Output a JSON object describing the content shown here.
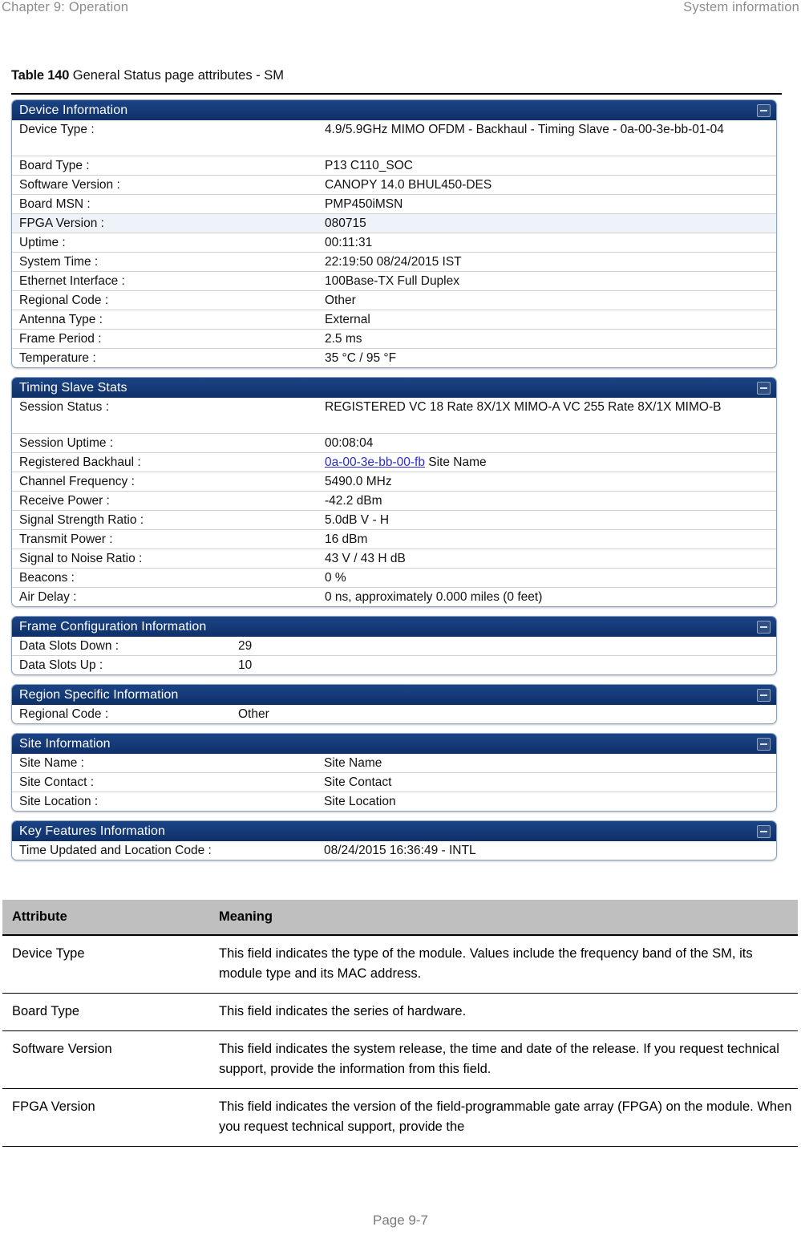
{
  "running_head": {
    "left": "Chapter 9:  Operation",
    "right": "System information"
  },
  "caption": {
    "number": "Table 140",
    "text": "General Status page attributes - SM"
  },
  "colors": {
    "panel_header_bg": "#123a77",
    "panel_border": "#8ea4bf",
    "row_highlight": "#eef3fa",
    "link": "#2b2bcc",
    "table_header_bg": "#bfbfbf"
  },
  "screenshot": {
    "collapse_icon": "minus-icon",
    "panels": [
      {
        "title": "Device Information",
        "rows": [
          {
            "label": "Device Type :",
            "value": "4.9/5.9GHz MIMO OFDM - Backhaul - Timing Slave - 0a-00-3e-bb-01-04",
            "two_line": true
          },
          {
            "label": "Board Type :",
            "value": "P13 C110_SOC"
          },
          {
            "label": "Software Version :",
            "value": "CANOPY 14.0  BHUL450-DES"
          },
          {
            "label": "Board MSN :",
            "value": "PMP450iMSN"
          },
          {
            "label": "FPGA Version :",
            "value": "080715",
            "highlight": true
          },
          {
            "label": "Uptime :",
            "value": "00:11:31"
          },
          {
            "label": "System Time :",
            "value": "22:19:50 08/24/2015 IST"
          },
          {
            "label": "Ethernet Interface :",
            "value": "100Base-TX Full Duplex"
          },
          {
            "label": "Regional Code :",
            "value": "Other"
          },
          {
            "label": "Antenna Type :",
            "value": "External"
          },
          {
            "label": "Frame Period :",
            "value": "2.5 ms"
          },
          {
            "label": "Temperature :",
            "value": "35 °C / 95 °F"
          }
        ]
      },
      {
        "title": "Timing Slave Stats",
        "rows": [
          {
            "label": "Session Status :",
            "value": "REGISTERED VC 18 Rate 8X/1X MIMO-A VC 255 Rate 8X/1X MIMO-B",
            "two_line": true
          },
          {
            "label": "Session Uptime :",
            "value": "00:08:04"
          },
          {
            "label": "Registered Backhaul :",
            "value": "0a-00-3e-bb-00-fb Site Name",
            "link_text": "0a-00-3e-bb-00-fb",
            "link_suffix": " Site Name"
          },
          {
            "label": "Channel Frequency :",
            "value": "5490.0 MHz"
          },
          {
            "label": "Receive Power :",
            "value": "-42.2 dBm"
          },
          {
            "label": "Signal Strength Ratio :",
            "value": "5.0dB V - H"
          },
          {
            "label": "Transmit Power :",
            "value": "16 dBm"
          },
          {
            "label": "Signal to Noise Ratio :",
            "value": "43 V / 43 H dB"
          },
          {
            "label": "Beacons :",
            "value": "0 %"
          },
          {
            "label": "Air Delay :",
            "value": "0 ns, approximately 0.000 miles (0 feet)"
          }
        ]
      },
      {
        "title": "Frame Configuration Information",
        "rows": [
          {
            "label": "Data Slots Down :",
            "value": "29"
          },
          {
            "label": "Data Slots Up :",
            "value": "10"
          }
        ]
      },
      {
        "title": "Region Specific Information",
        "rows": [
          {
            "label": "Regional Code :",
            "value": "Other"
          }
        ]
      },
      {
        "title": "Site Information",
        "rows": [
          {
            "label": "Site Name :",
            "value": "Site Name"
          },
          {
            "label": "Site Contact :",
            "value": "Site Contact"
          },
          {
            "label": "Site Location :",
            "value": "Site Location"
          }
        ]
      },
      {
        "title": "Key Features Information",
        "rows": [
          {
            "label": "Time Updated and Location Code :",
            "value": "08/24/2015 16:36:49 - INTL"
          }
        ]
      }
    ]
  },
  "attribute_table": {
    "headers": [
      "Attribute",
      "Meaning"
    ],
    "rows": [
      {
        "attribute": "Device Type",
        "meaning": "This field indicates the type of the module. Values include the frequency band of the SM, its module type and its MAC address."
      },
      {
        "attribute": "Board Type",
        "meaning": "This field indicates the series of hardware."
      },
      {
        "attribute": "Software Version",
        "meaning": "This field indicates the system release, the time and date of the release. If you request technical support, provide the information from this field."
      },
      {
        "attribute": "FPGA Version",
        "meaning": "This field indicates the version of the field-programmable gate array (FPGA) on the module.  When you request technical support, provide the"
      }
    ]
  },
  "footer": {
    "page_label": "Page 9-7"
  }
}
